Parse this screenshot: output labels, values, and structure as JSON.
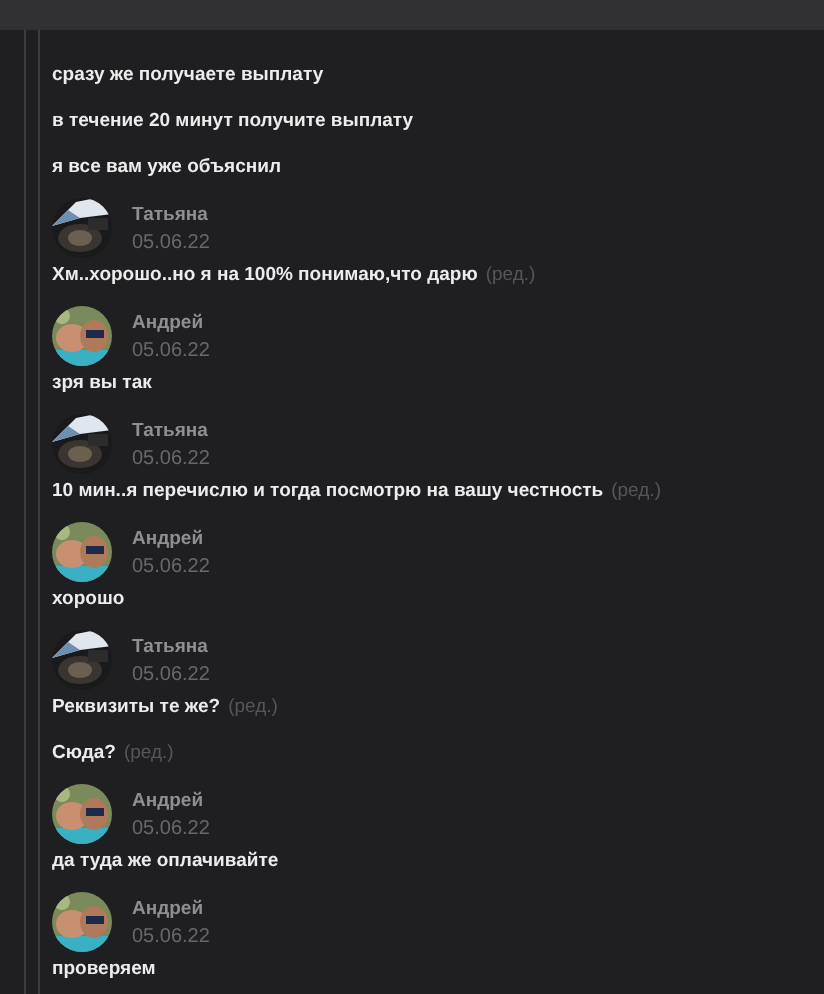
{
  "groups": [
    {
      "messages": [
        {
          "text": "сразу же получаете выплату"
        },
        {
          "text": "в течение 20 минут получите выплату"
        },
        {
          "text": "я все вам уже объяснил"
        }
      ]
    },
    {
      "author": "Татьяна",
      "date": "05.06.22",
      "messages": [
        {
          "text": "Хм..хорошо..но я на 100% понимаю,что дарю",
          "edit_mark": "(ред.)"
        }
      ]
    },
    {
      "author": "Андрей",
      "date": "05.06.22",
      "messages": [
        {
          "text": "зря вы так"
        }
      ]
    },
    {
      "author": "Татьяна",
      "date": "05.06.22",
      "messages": [
        {
          "text": "10 мин..я перечислю и тогда посмотрю на вашу честность",
          "edit_mark": "(ред.)"
        }
      ]
    },
    {
      "author": "Андрей",
      "date": "05.06.22",
      "messages": [
        {
          "text": "хорошо"
        }
      ]
    },
    {
      "author": "Татьяна",
      "date": "05.06.22",
      "messages": [
        {
          "text": "Реквизиты те же?",
          "edit_mark": "(ред.)"
        },
        {
          "text": "Сюда?",
          "edit_mark": "(ред.)"
        }
      ]
    },
    {
      "author": "Андрей",
      "date": "05.06.22",
      "messages": [
        {
          "text": "да туда же оплачивайте"
        }
      ]
    },
    {
      "author": "Андрей",
      "date": "05.06.22",
      "messages": [
        {
          "text": "проверяем"
        }
      ]
    }
  ]
}
